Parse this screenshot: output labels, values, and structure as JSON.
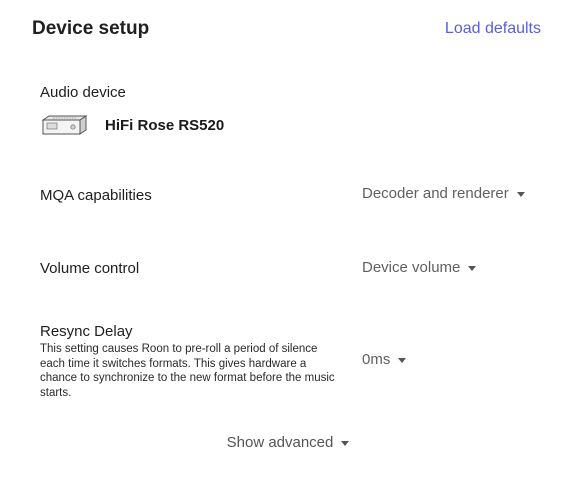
{
  "header": {
    "title": "Device setup",
    "load_defaults": "Load defaults"
  },
  "audio_device": {
    "label": "Audio device",
    "icon": "audio-device-icon",
    "name": "HiFi Rose RS520"
  },
  "mqa": {
    "label": "MQA capabilities",
    "value": "Decoder and renderer"
  },
  "volume": {
    "label": "Volume control",
    "value": "Device volume"
  },
  "resync": {
    "label": "Resync Delay",
    "description": "This setting causes Roon to pre-roll a period of silence each time it switches formats. This gives hardware a chance to synchronize to the new format before the music starts.",
    "value": "0ms"
  },
  "footer": {
    "show_advanced": "Show advanced"
  },
  "colors": {
    "accent": "#5b5fd6"
  }
}
